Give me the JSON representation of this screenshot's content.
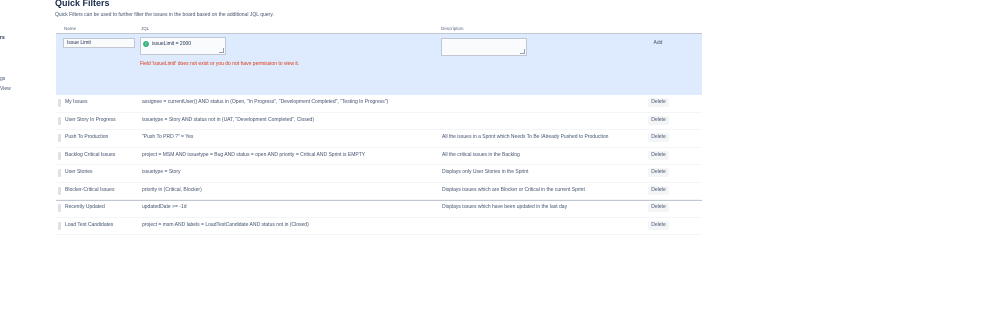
{
  "sidebar": {
    "frag1": "rs",
    "frag2": "gs",
    "frag3": "View"
  },
  "header": {
    "title": "Quick Filters",
    "description": "Quick Filters can be used to further filter the issues in the board based on the additional JQL query."
  },
  "columns": {
    "name": "Name",
    "jql": "JQL",
    "description": "Description"
  },
  "new_filter": {
    "name_value": "Issue Limit",
    "jql_value": "issueLimit = 2000",
    "error": "Field 'issueLimit' does not exist or you do not have permission to view it.",
    "description_value": "",
    "add_label": "Add",
    "status_color": "#36b37e",
    "error_color": "#de350b"
  },
  "filters": [
    {
      "name": "My Issues",
      "jql": "assignee = currentUser() AND status in (Open, \"In Progress\", \"Development Completed\", \"Testing In Progress\")",
      "description": "",
      "delete_label": "Delete"
    },
    {
      "name": "User Story In Progress",
      "jql": "issuetype = Story AND status not in (UAT, \"Development Completed\", Closed)",
      "description": "",
      "delete_label": "Delete"
    },
    {
      "name": "Push To Production",
      "jql": "\"Push To PRD ?\" = Yes",
      "description": "All the issues in a Sprint which Needs To Be /Already Pushed to Production",
      "delete_label": "Delete"
    },
    {
      "name": "Backlog Critical Issues",
      "jql": "project = MSM AND issuetype = Bug AND status = open AND priority = Critical AND Sprint is EMPTY",
      "description": "All the critical issues in the Backlog",
      "delete_label": "Delete"
    },
    {
      "name": "User Stories",
      "jql": "issuetype = Story",
      "description": "Displays only User Stories in the Sprint",
      "delete_label": "Delete"
    },
    {
      "name": "Blocker-Critical Issues",
      "jql": "priority in (Critical, Blocker)",
      "description": "Displays issues which are Blocker or Critical in the current Sprint",
      "delete_label": "Delete"
    },
    {
      "name": "Recently Updated",
      "jql": "updatedDate >= -1d",
      "description": "Displays issues which have been updated in the last day",
      "delete_label": "Delete"
    },
    {
      "name": "Load Test Candidates",
      "jql": "project = msm AND labels = LoadTestCandidate AND status not in (Closed)",
      "description": "",
      "delete_label": "Delete"
    }
  ]
}
